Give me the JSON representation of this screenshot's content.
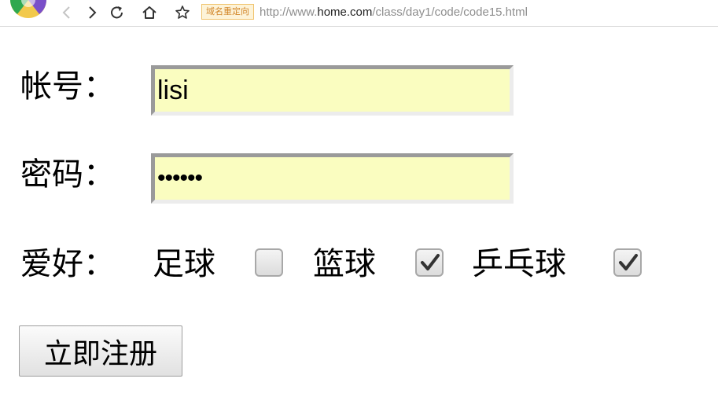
{
  "browser": {
    "redirect_badge": "域名重定向",
    "url_scheme": "http://www.",
    "url_host": "home.com",
    "url_path": "/class/day1/code/code15.html"
  },
  "form": {
    "account_label": "帐号：",
    "account_value": "lisi",
    "password_label": "密码：",
    "password_value": "••••••",
    "hobby_label": "爱好：",
    "hobbies": [
      {
        "label": "足球",
        "checked": false
      },
      {
        "label": "篮球",
        "checked": true
      },
      {
        "label": "乒乓球",
        "checked": true
      }
    ],
    "submit_label": "立即注册"
  }
}
